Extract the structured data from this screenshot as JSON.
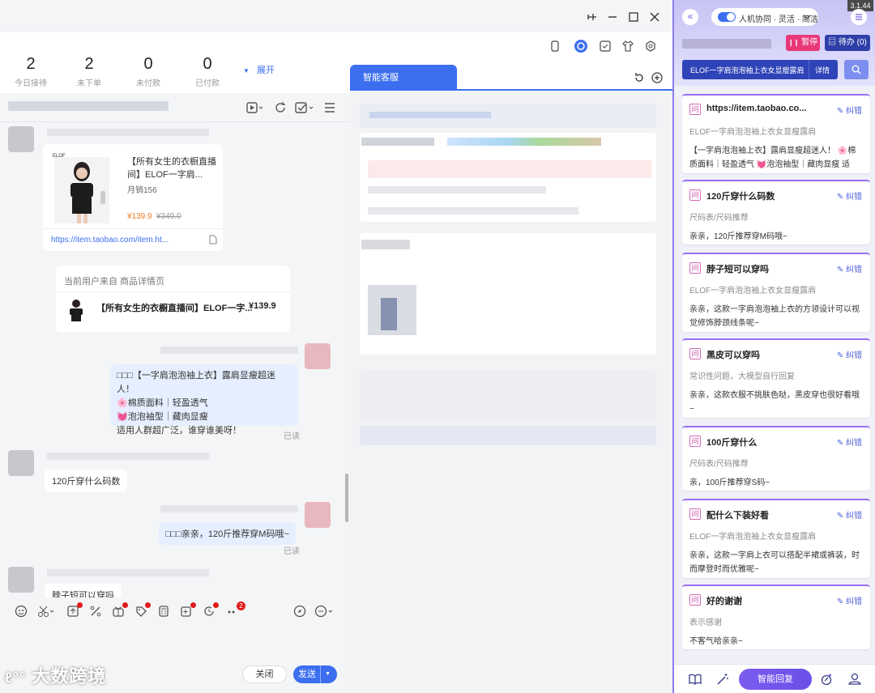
{
  "version": "3.1.44",
  "stats": [
    {
      "num": "2",
      "label": "今日接待"
    },
    {
      "num": "2",
      "label": "未下单"
    },
    {
      "num": "0",
      "label": "未付款"
    },
    {
      "num": "0",
      "label": "已付款"
    }
  ],
  "expand_label": "展开",
  "product_card": {
    "brand": "ELOF",
    "title": "【所有女生的衣橱直播间】ELOF一字肩...",
    "sales": "月销156",
    "price": "¥139.9",
    "old_price": "¥349.0",
    "link": "https://item.taobao.com/item.ht..."
  },
  "source_card": {
    "from_text": "当前用户来自 商品详情页",
    "title": "【所有女生的衣橱直播间】ELOF一字...",
    "price": "¥139.9"
  },
  "messages": {
    "m1": [
      "□□□【一字肩泡泡袖上衣】露肩显瘦超迷人！",
      "🌸棉质面料｜轻盈透气",
      "💓泡泡袖型｜藏肉显瘦",
      "适用人群超广泛，谁穿谁美呀！"
    ],
    "read": "已读",
    "q1": "120斤穿什么码数",
    "a1": "□□□亲亲，120斤推荐穿M码哦~",
    "q2": "脖子短可以穿吗"
  },
  "buttons": {
    "close": "关闭",
    "send": "发送"
  },
  "watermark": "大数跨境",
  "badge_count": "2",
  "mid_tab": "智能客服",
  "right": {
    "mode": "人机协同 · 灵活 · 简洁",
    "pause": "暂停",
    "todo": "待办 (0)",
    "product_select": "ELOF一字肩泡泡袖上衣女显瘦露肩",
    "detail": "详情",
    "fix_label": "纠错",
    "cards": [
      {
        "title": "https://item.taobao.co...",
        "sub": "ELOF一字肩泡泡袖上衣女显瘦露肩",
        "ans": "【一字肩泡泡袖上衣】露肩显瘦超迷人！ 🌸棉质面料｜轻盈透气 💓泡泡袖型｜藏肉显瘦 适用..."
      },
      {
        "title": "120斤穿什么码数",
        "sub": "尺码表/尺码推荐",
        "ans": "亲亲，120斤推荐穿M码哦~"
      },
      {
        "title": "脖子短可以穿吗",
        "sub": "ELOF一字肩泡泡袖上衣女显瘦露肩",
        "ans": "亲亲，这款一字肩泡泡袖上衣的方领设计可以视觉修饰脖颈线条呢~"
      },
      {
        "title": "黑皮可以穿吗",
        "sub": "常识性问题，大模型自行回复",
        "ans": "亲亲，这款衣服不挑肤色哒，黑皮穿也很好看哦~"
      },
      {
        "title": "100斤穿什么",
        "sub": "尺码表/尺码推荐",
        "ans": "亲，100斤推荐穿S码~"
      },
      {
        "title": "配什么下装好看",
        "sub": "ELOF一字肩泡泡袖上衣女显瘦露肩",
        "ans": "亲亲，这款一字肩上衣可以搭配半裙或裤装，时而摩登时而优雅呢~"
      },
      {
        "title": "好的谢谢",
        "sub": "表示感谢",
        "ans": "不客气哈亲亲~"
      }
    ],
    "smart_reply": "智能回复"
  },
  "colors": {
    "accent": "#3c6ef0",
    "purple": "#7c5cf0",
    "pink": "#e8387a",
    "price": "#f07b22"
  }
}
